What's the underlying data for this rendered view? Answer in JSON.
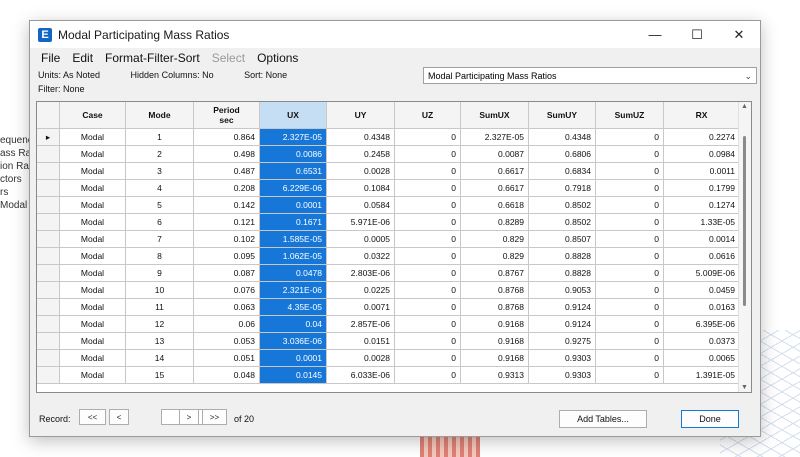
{
  "background": {
    "left_panel_items": [
      "equenci",
      "ass Rat",
      "ion Rati",
      "ctors",
      "rs",
      "Modal In"
    ]
  },
  "window": {
    "title": "Modal Participating Mass Ratios",
    "app_icon_letter": "E",
    "controls": {
      "minimize": "—",
      "maximize": "☐",
      "close": "✕"
    }
  },
  "menu": [
    "File",
    "Edit",
    "Format-Filter-Sort",
    "Select",
    "Options"
  ],
  "info": {
    "units": "Units: As Noted",
    "hidden_columns": "Hidden Columns: No",
    "sort": "Sort: None",
    "filter": "Filter: None"
  },
  "table_selector": {
    "value": "Modal Participating Mass Ratios"
  },
  "table": {
    "columns": [
      "Case",
      "Mode",
      "Period\nsec",
      "UX",
      "UY",
      "UZ",
      "SumUX",
      "SumUY",
      "SumUZ",
      "RX"
    ],
    "rows": [
      [
        "Modal",
        "1",
        "0.864",
        "2.327E-05",
        "0.4348",
        "0",
        "2.327E-05",
        "0.4348",
        "0",
        "0.2274"
      ],
      [
        "Modal",
        "2",
        "0.498",
        "0.0086",
        "0.2458",
        "0",
        "0.0087",
        "0.6806",
        "0",
        "0.0984"
      ],
      [
        "Modal",
        "3",
        "0.487",
        "0.6531",
        "0.0028",
        "0",
        "0.6617",
        "0.6834",
        "0",
        "0.0011"
      ],
      [
        "Modal",
        "4",
        "0.208",
        "6.229E-06",
        "0.1084",
        "0",
        "0.6617",
        "0.7918",
        "0",
        "0.1799"
      ],
      [
        "Modal",
        "5",
        "0.142",
        "0.0001",
        "0.0584",
        "0",
        "0.6618",
        "0.8502",
        "0",
        "0.1274"
      ],
      [
        "Modal",
        "6",
        "0.121",
        "0.1671",
        "5.971E-06",
        "0",
        "0.8289",
        "0.8502",
        "0",
        "1.33E-05"
      ],
      [
        "Modal",
        "7",
        "0.102",
        "1.585E-05",
        "0.0005",
        "0",
        "0.829",
        "0.8507",
        "0",
        "0.0014"
      ],
      [
        "Modal",
        "8",
        "0.095",
        "1.062E-05",
        "0.0322",
        "0",
        "0.829",
        "0.8828",
        "0",
        "0.0616"
      ],
      [
        "Modal",
        "9",
        "0.087",
        "0.0478",
        "2.803E-06",
        "0",
        "0.8767",
        "0.8828",
        "0",
        "5.009E-06"
      ],
      [
        "Modal",
        "10",
        "0.076",
        "2.321E-06",
        "0.0225",
        "0",
        "0.8768",
        "0.9053",
        "0",
        "0.0459"
      ],
      [
        "Modal",
        "11",
        "0.063",
        "4.35E-05",
        "0.0071",
        "0",
        "0.8768",
        "0.9124",
        "0",
        "0.0163"
      ],
      [
        "Modal",
        "12",
        "0.06",
        "0.04",
        "2.857E-06",
        "0",
        "0.9168",
        "0.9124",
        "0",
        "6.395E-06"
      ],
      [
        "Modal",
        "13",
        "0.053",
        "3.036E-06",
        "0.0151",
        "0",
        "0.9168",
        "0.9275",
        "0",
        "0.0373"
      ],
      [
        "Modal",
        "14",
        "0.051",
        "0.0001",
        "0.0028",
        "0",
        "0.9168",
        "0.9303",
        "0",
        "0.0065"
      ],
      [
        "Modal",
        "15",
        "0.048",
        "0.0145",
        "6.033E-06",
        "0",
        "0.9313",
        "0.9303",
        "0",
        "1.391E-05"
      ]
    ]
  },
  "footer": {
    "record_label": "Record:",
    "first": "<<",
    "prev": "<",
    "record_value": "1",
    "next": ">",
    "last": ">>",
    "of_label": "of 20",
    "add_tables": "Add Tables...",
    "done": "Done"
  },
  "colors": {
    "accent": "#1677d9",
    "header_selected": "#c5def3"
  }
}
